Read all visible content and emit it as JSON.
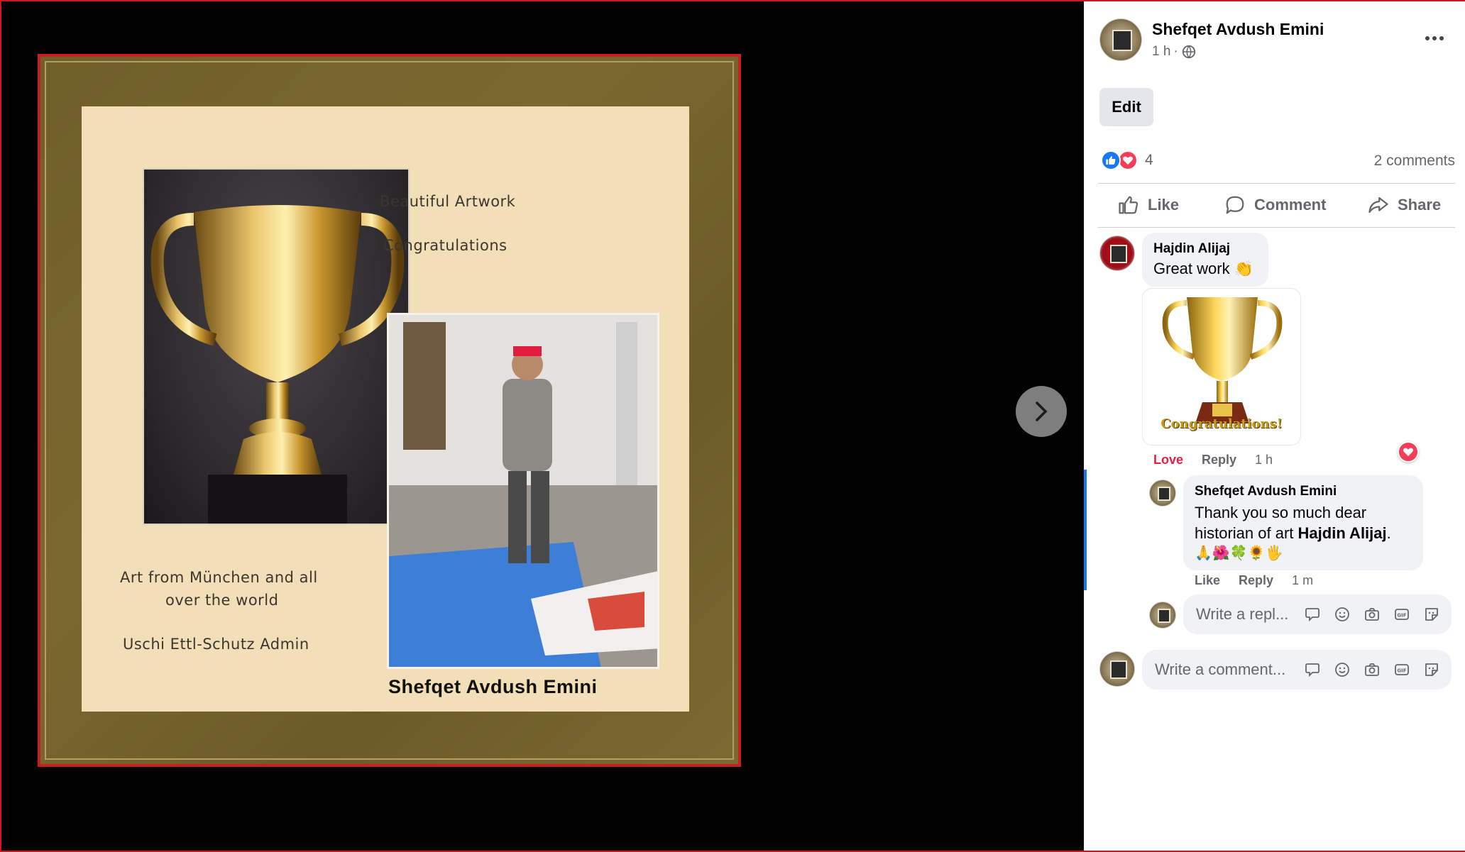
{
  "photo": {
    "line1": "Beautiful Artwork",
    "line2": "Congratulations",
    "line3": "Art from München and all",
    "line4": "over the world",
    "line5": "Uschi Ettl-Schutz Admin",
    "signature": "Shefqet Avdush Emini"
  },
  "post": {
    "author": "Shefqet Avdush Emini",
    "time": "1 h",
    "separator": "·",
    "privacy_icon": "globe-icon",
    "more_icon": "more-icon",
    "edit_label": "Edit",
    "reaction_count": "4",
    "comments_count": "2 comments",
    "actions": {
      "like": "Like",
      "comment": "Comment",
      "share": "Share"
    }
  },
  "comments": [
    {
      "author": "Hajdin Alijaj",
      "text": "Great work",
      "emoji": "👏",
      "sticker_text": "Congratulations!",
      "reaction_label": "Love",
      "reply_label": "Reply",
      "time": "1 h"
    }
  ],
  "reply": {
    "author": "Shefqet Avdush Emini",
    "text_line1": "Thank you so much dear",
    "text_line2": "historian of art",
    "mention": "Hajdin Alijaj",
    "period": ".",
    "emojis": "🙏🌺🍀🌻🖐",
    "like_label": "Like",
    "reply_label": "Reply",
    "time": "1 m"
  },
  "reply_input": {
    "placeholder": "Write a repl..."
  },
  "comment_input": {
    "placeholder": "Write a comment..."
  },
  "colors": {
    "love": "#e41e3f",
    "like_blue": "#1877f2",
    "panel_bg": "#ffffff",
    "viewer_bg": "#000000"
  }
}
